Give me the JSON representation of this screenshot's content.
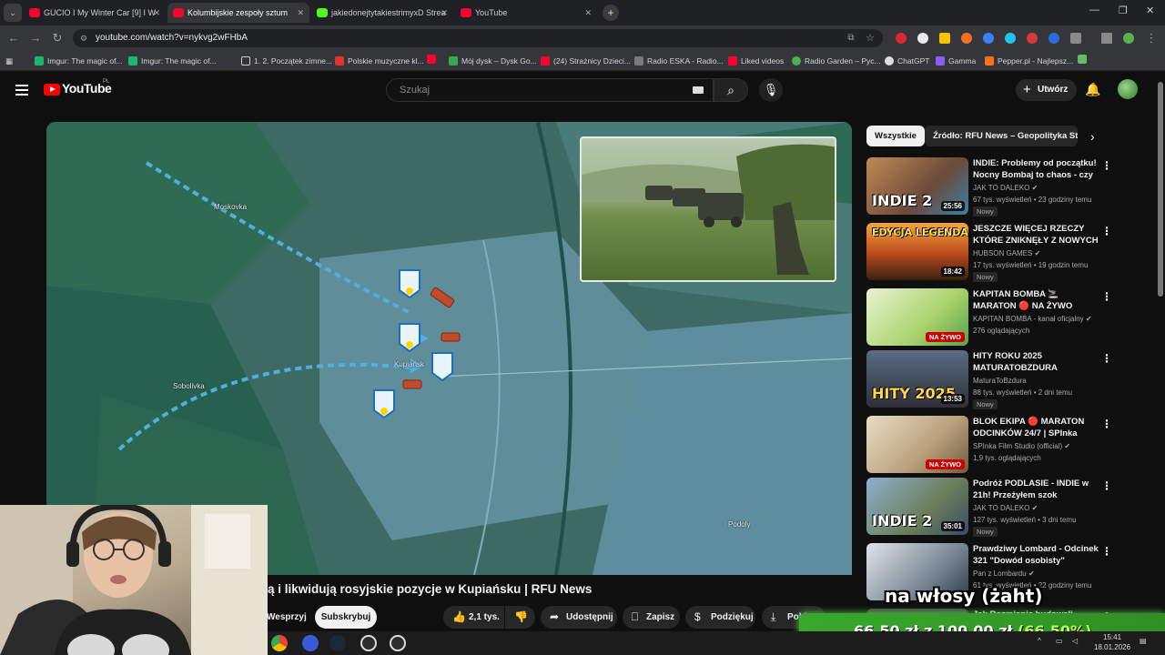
{
  "browser": {
    "tabs": [
      {
        "title": "GUCIO I My Winter Car [9] I W",
        "active": false
      },
      {
        "title": "Kolumbijskie zespoły sztum",
        "active": true
      },
      {
        "title": "jakiedonejtytakiestrimyxD Strea",
        "active": false
      },
      {
        "title": "YouTube",
        "active": false
      }
    ],
    "url": "youtube.com/watch?v=nykvg2wFHbA",
    "bookmarks": [
      "Imgur: The magic of...",
      "Imgur: The magic of...",
      "1. 2. Początek zimne...",
      "Polskie muzyczne kl...",
      "Mój dysk – Dysk Go...",
      "(24) Strażnicy Dzieci...",
      "Radio ESKA - Radio...",
      "Liked videos",
      "Radio Garden – Pyc...",
      "ChatGPT",
      "Gamma",
      "Pepper.pl - Najlepsz..."
    ]
  },
  "youtube": {
    "logo_text": "YouTube",
    "region": "PL",
    "search_placeholder": "Szukaj",
    "create_label": "Utwórz"
  },
  "video": {
    "map_labels": {
      "moskovka": "Moskovka",
      "kupiansk": "Kupiańsk",
      "sobolivka": "Sobolivka",
      "podoly": "Podoly"
    },
    "title": "ą i likwidują rosyjskie pozycje w Kupiańsku | RFU News",
    "support_label": "Wesprzyj",
    "subscribe_label": "Subskrybuj",
    "likes": "2,1 tys.",
    "share_label": "Udostępnij",
    "save_label": "Zapisz",
    "thanks_label": "Podziękuj",
    "download_label": "Pobierz"
  },
  "sidebar": {
    "chips": [
      "Wszystkie",
      "Źródło: RFU News – Geopolityka Strat"
    ],
    "items": [
      {
        "title": "INDIE: Problemy od początku! Nocny Bombaj to chaos - czy ...",
        "channel": "JAK TO DALEKO",
        "meta": "67 tys. wyświetleń • 23 godziny temu",
        "badge": "Nowy",
        "duration": "25:56",
        "thumb_text": "INDIE 2"
      },
      {
        "title": "JESZCZE WIĘCEJ RZECZY KTÓRE ZNIKNĘŁY Z NOWYCH ...",
        "channel": "HUBSON GAMES",
        "meta": "17 tys. wyświetleń • 19 godzin temu",
        "badge": "Nowy",
        "duration": "18:42",
        "thumb_text": "EDYCJA LEGENDA"
      },
      {
        "title": "KAPITAN BOMBA 🚬 MARATON 🔴 NA ŻYWO",
        "channel": "KAPITAN BOMBA - kanał oficjalny",
        "meta": "276 oglądających",
        "badge": "",
        "duration": "NA ŻYWO",
        "thumb_text": ""
      },
      {
        "title": "HITY ROKU 2025 MATURATOBZDURA",
        "channel": "MaturaToBzdura",
        "meta": "88 tys. wyświetleń • 2 dni temu",
        "badge": "Nowy",
        "duration": "13:53",
        "thumb_text": "HITY 2025"
      },
      {
        "title": "BLOK EKIPA 🔴 MARATON ODCINKÓW 24/7 | SPInka Film...",
        "channel": "SPInka Film Studio (official)",
        "meta": "1,9 tys. oglądających",
        "badge": "",
        "duration": "NA ŻYWO",
        "thumb_text": ""
      },
      {
        "title": "Podróż PODLASIE - INDIE w 21h! Przeżyłem szok kulturow...",
        "channel": "JAK TO DALEKO",
        "meta": "127 tys. wyświetleń • 3 dni temu",
        "badge": "Nowy",
        "duration": "35:01",
        "thumb_text": "INDIE 2"
      },
      {
        "title": "Prawdziwy Lombard - Odcinek 321 \"Dowód osobisty\"",
        "channel": "Pan z Lombardu",
        "meta": "61 tys. wyświetleń • 22 godziny temu",
        "badge": "",
        "duration": "",
        "thumb_text": ""
      },
      {
        "title": "Jak Rozmianie budowali",
        "channel": "",
        "meta": "",
        "badge": "",
        "duration": "",
        "thumb_text": ""
      }
    ]
  },
  "overlay": {
    "caption": "na włosy (żaht)",
    "donation_current": "66,50 zł",
    "donation_sep": "z",
    "donation_goal": "100,00 zł",
    "donation_percent": "(66.50%)"
  },
  "taskbar": {
    "time": "15:41",
    "date": "18.01.2026"
  }
}
